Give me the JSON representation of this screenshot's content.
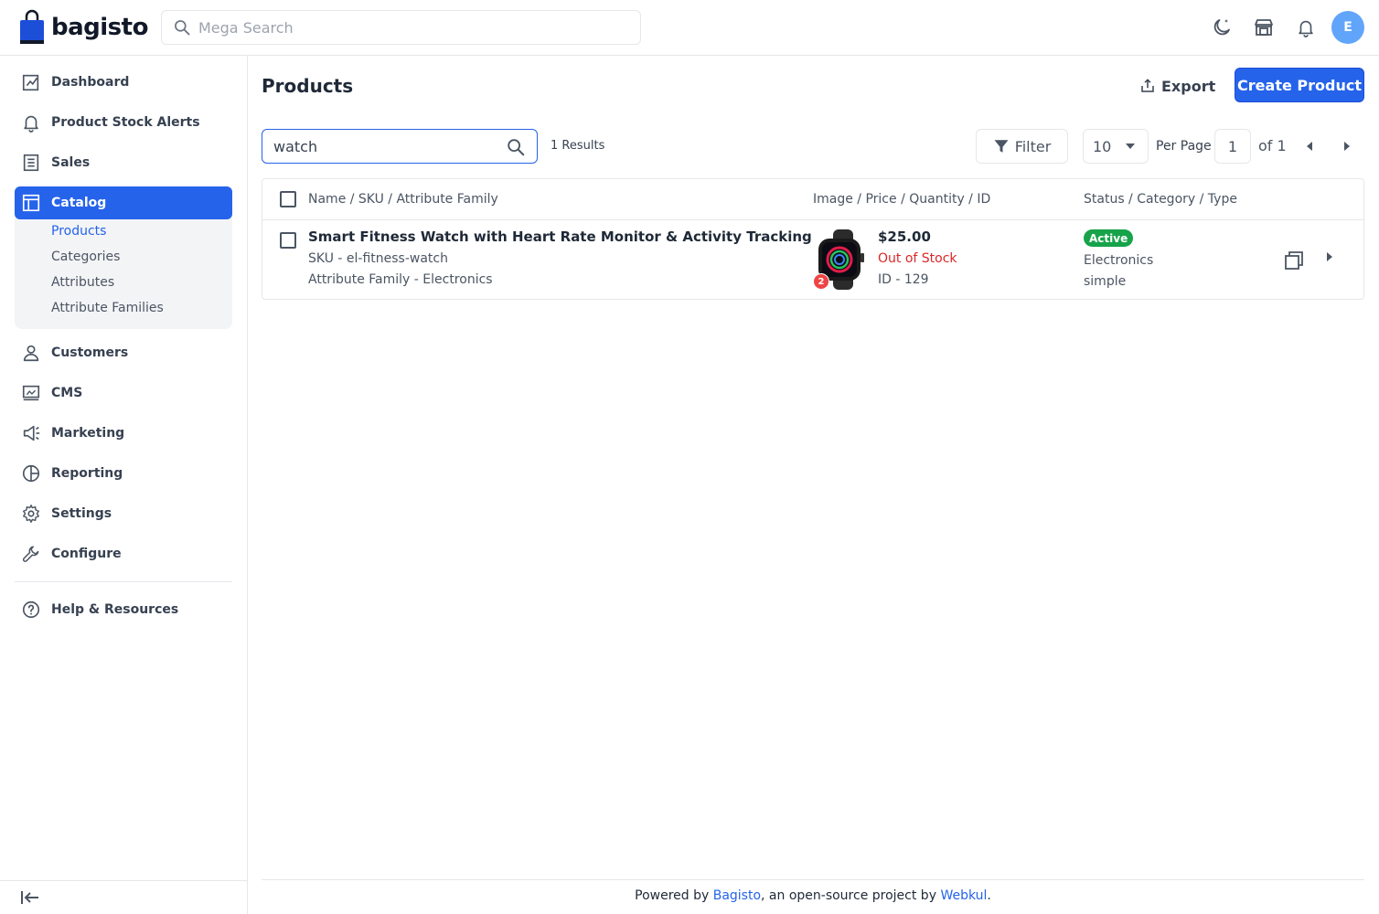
{
  "header": {
    "logo_text": "bagisto",
    "search_placeholder": "Mega Search",
    "avatar_initial": "E"
  },
  "sidebar": {
    "items": [
      {
        "label": "Dashboard",
        "icon": "dashboard-icon"
      },
      {
        "label": "Product Stock Alerts",
        "icon": "bell-icon"
      },
      {
        "label": "Sales",
        "icon": "receipt-icon"
      },
      {
        "label": "Catalog",
        "icon": "catalog-icon",
        "active": true
      },
      {
        "label": "Customers",
        "icon": "user-icon"
      },
      {
        "label": "CMS",
        "icon": "monitor-icon"
      },
      {
        "label": "Marketing",
        "icon": "megaphone-icon"
      },
      {
        "label": "Reporting",
        "icon": "pie-chart-icon"
      },
      {
        "label": "Settings",
        "icon": "gear-icon"
      },
      {
        "label": "Configure",
        "icon": "wrench-icon"
      },
      {
        "label": "Help & Resources",
        "icon": "help-icon"
      }
    ],
    "catalog_sub": [
      {
        "label": "Products",
        "active": true
      },
      {
        "label": "Categories"
      },
      {
        "label": "Attributes"
      },
      {
        "label": "Attribute Families"
      }
    ]
  },
  "page": {
    "title": "Products",
    "export_label": "Export",
    "create_label": "Create Product"
  },
  "toolbar": {
    "search_value": "watch",
    "results_text": "1 Results",
    "filter_label": "Filter",
    "per_page_value": "10",
    "per_page_label": "Per Page",
    "current_page": "1",
    "of_pages": "of 1"
  },
  "table": {
    "headers": [
      "Name / SKU / Attribute Family",
      "Image / Price / Quantity / ID",
      "Status / Category / Type"
    ],
    "rows": [
      {
        "name": "Smart Fitness Watch with Heart Rate Monitor & Activity Tracking",
        "sku": "SKU - el-fitness-watch",
        "family": "Attribute Family - Electronics",
        "image_count": "2",
        "price": "$25.00",
        "stock": "Out of Stock",
        "id": "ID - 129",
        "status": "Active",
        "category": "Electronics",
        "type": "simple"
      }
    ]
  },
  "footer": {
    "prefix": "Powered by ",
    "link1": "Bagisto",
    "middle": ", an open-source project by ",
    "link2": "Webkul",
    "suffix": "."
  },
  "colors": {
    "accent": "#2563eb",
    "active_badge": "#16a34a",
    "out_of_stock": "#dc2626"
  }
}
